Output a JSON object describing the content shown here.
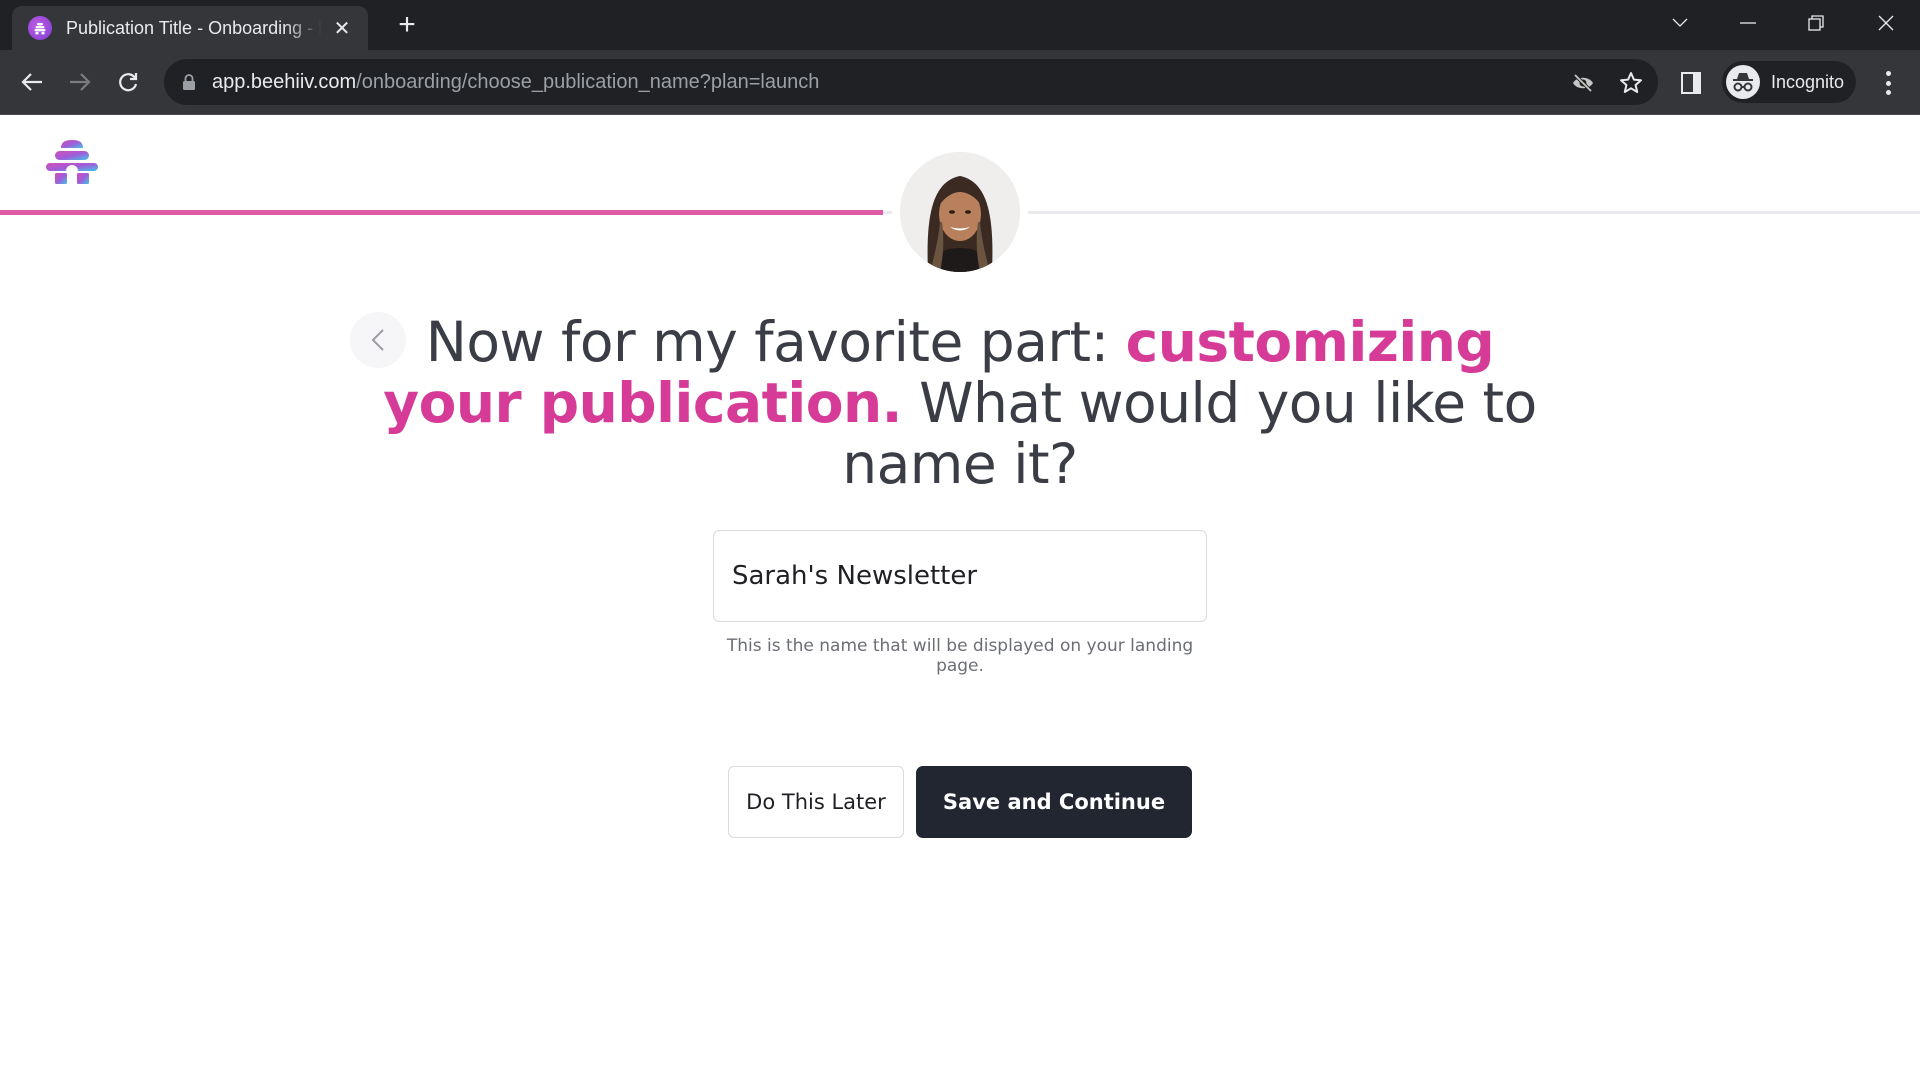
{
  "browser": {
    "tab": {
      "title": "Publication Title - Onboarding - beehiiv",
      "favicon": "beehiiv-hive-icon",
      "close": "✕"
    },
    "new_tab": "+",
    "window_controls": [
      "tab-search-icon",
      "minimize-icon",
      "restore-icon",
      "close-window-icon"
    ],
    "url": {
      "host": "app.beehiiv.com",
      "path": "/onboarding/choose_publication_name?plan=launch"
    },
    "profile_label": "Incognito",
    "toolbar_icons": [
      "back-arrow-icon",
      "forward-arrow-icon",
      "reload-icon",
      "lock-icon",
      "eye-off-icon",
      "star-icon",
      "side-panel-icon",
      "incognito-icon",
      "more-vert-icon"
    ]
  },
  "page": {
    "logo": "beehiiv-logo",
    "progress": {
      "percent": 46,
      "color": "#dc5aa6"
    },
    "avatar_alt": "Onboarding guide photo",
    "heading": {
      "part1": "Now for my favorite part: ",
      "accent": "customizing your publication.",
      "part2": " What would you like to name it?",
      "accent_color": "#d63b98"
    },
    "name_input": {
      "value": "Sarah's Newsletter",
      "helper": "This is the name that will be displayed on your landing page."
    },
    "buttons": {
      "later": "Do This Later",
      "save": "Save and Continue"
    }
  }
}
